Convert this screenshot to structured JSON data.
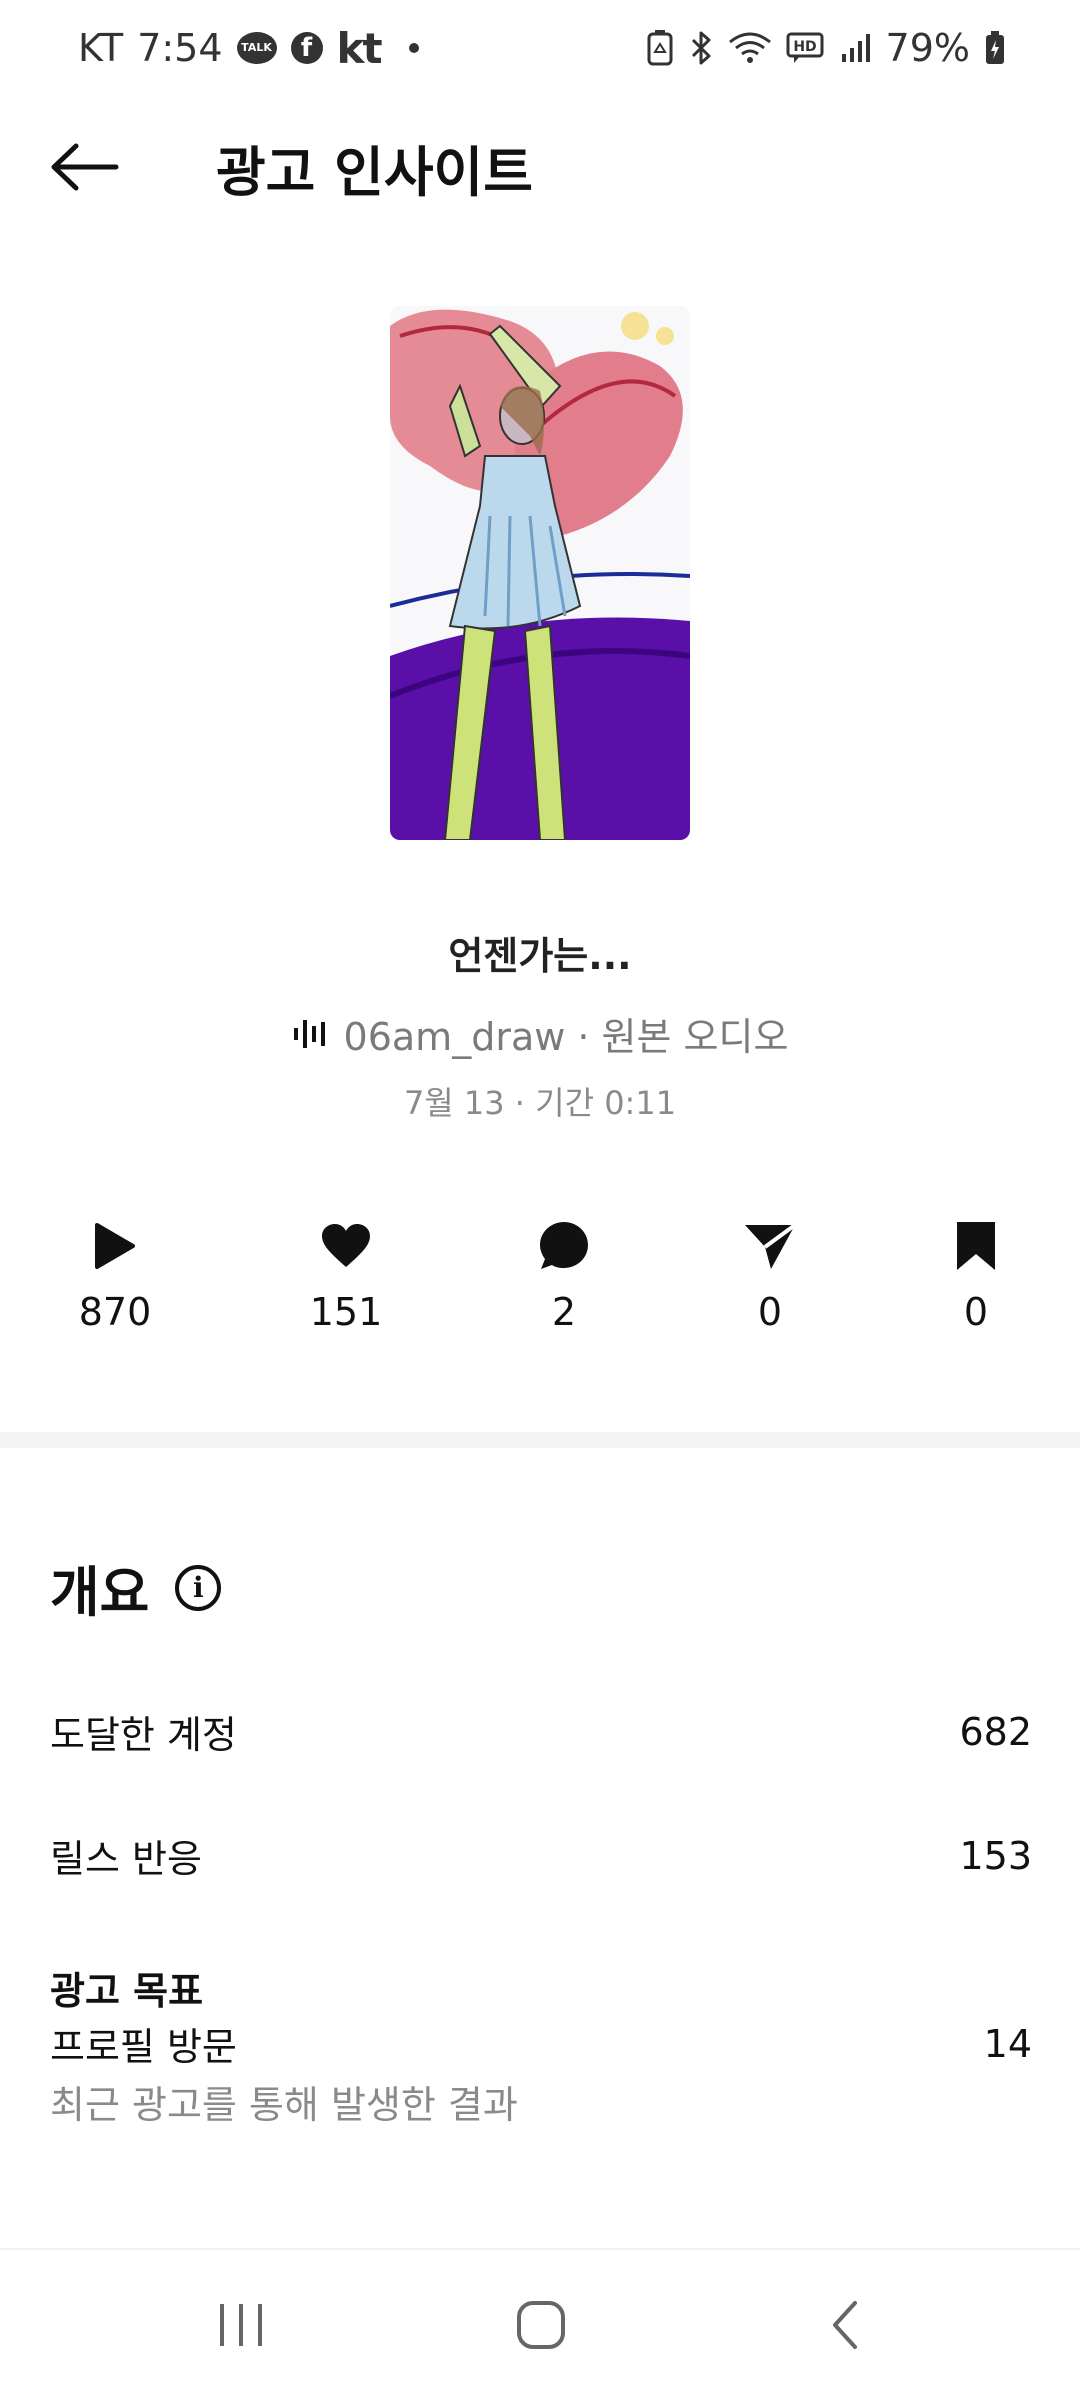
{
  "status_bar": {
    "carrier": "KT",
    "time": "7:54",
    "talk_label": "TALK",
    "fb_letter": "f",
    "kt_logo": "kt",
    "battery": "79%"
  },
  "header": {
    "title": "광고 인사이트"
  },
  "reel": {
    "title": "언젠가는...",
    "audio": "06am_draw · 원본 오디오",
    "meta": "7월 13 · 기간 0:11"
  },
  "stats": {
    "plays": "870",
    "likes": "151",
    "comments": "2",
    "shares": "0",
    "saves": "0"
  },
  "overview": {
    "title": "개요",
    "info_glyph": "i",
    "accounts_reached_label": "도달한 계정",
    "accounts_reached_value": "682",
    "reel_interactions_label": "릴스 반응",
    "reel_interactions_value": "153",
    "ad_goal_label": "광고 목표",
    "profile_visits_label": "프로필 방문",
    "profile_visits_value": "14",
    "ad_goal_note": "최근 광고를 통해 발생한 결과"
  },
  "icons": {
    "back": "arrow-left-icon",
    "play": "play-icon",
    "like": "heart-icon",
    "comment": "comment-icon",
    "share": "send-icon",
    "save": "bookmark-icon",
    "info": "info-icon",
    "audio": "audio-wave-icon"
  }
}
